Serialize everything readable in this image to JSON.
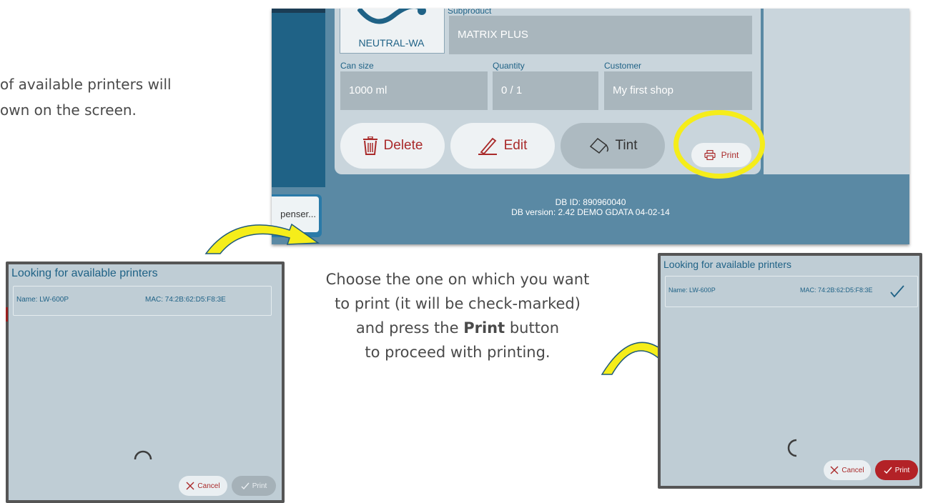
{
  "instructions": {
    "top_line1": "of available  printers will",
    "top_line2": "own on the screen.",
    "mid_line1": "Choose the one on which you want",
    "mid_line2": "to print (it will be check-marked)",
    "mid_line3_pre": "and press the ",
    "mid_line3_bold": "Print",
    "mid_line3_post": " button",
    "mid_line4": "to proceed with printing."
  },
  "app": {
    "logo_text": "NEUTRAL-WA",
    "subproduct_label": "Subproduct",
    "subproduct_value": "MATRIX PLUS",
    "can_size_label": "Can size",
    "can_size_value": "1000 ml",
    "quantity_label": "Quantity",
    "quantity_value": "0 / 1",
    "customer_label": "Customer",
    "customer_value": "My first shop",
    "delete_label": "Delete",
    "edit_label": "Edit",
    "tint_label": "Tint",
    "print_label": "Print",
    "left_button_text": "penser...",
    "db_id": "DB ID: 890960040",
    "db_version": "DB version: 2.42  DEMO GDATA 04-02-14",
    "colors": {
      "background": "#5a89a4",
      "card": "#c9d5dc",
      "accent_red": "#a92a2a",
      "highlight": "#f5ed1a"
    }
  },
  "dialog_left": {
    "title": "Looking for available printers",
    "printer_name": "Name: LW-600P",
    "printer_mac": "MAC: 74:2B:62:D5:F8:3E",
    "cancel_label": "Cancel",
    "print_label": "Print",
    "selected": false
  },
  "dialog_right": {
    "title": "Looking for available printers",
    "printer_name": "Name: LW-600P",
    "printer_mac": "MAC: 74:2B:62:D5:F8:3E",
    "cancel_label": "Cancel",
    "print_label": "Print",
    "selected": true
  },
  "icons": [
    "trash-icon",
    "pencil-icon",
    "tint-icon",
    "printer-icon",
    "close-icon",
    "check-icon",
    "spinner-icon",
    "arrow-icon"
  ]
}
